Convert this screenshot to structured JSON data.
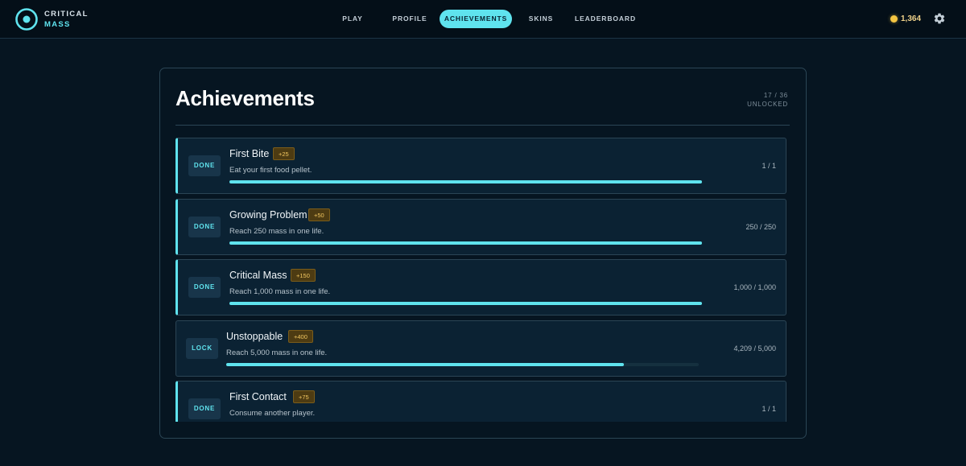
{
  "brand": {
    "line1": "CRITICAL",
    "line2": "MASS"
  },
  "nav": {
    "items": [
      {
        "label": "PLAY",
        "active": false
      },
      {
        "label": "PROFILE",
        "active": false
      },
      {
        "label": "ACHIEVEMENTS",
        "active": true
      },
      {
        "label": "SKINS",
        "active": false
      },
      {
        "label": "LEADERBOARD",
        "active": false
      }
    ]
  },
  "header": {
    "coins": "1,364",
    "coin_icon": "coin-icon",
    "settings_icon": "gear-icon"
  },
  "page": {
    "title": "Achievements",
    "unlocked_count": "17 / 36",
    "unlocked_label": "UNLOCKED"
  },
  "achievements": [
    {
      "status": "DONE",
      "title": "First Bite",
      "reward": "+25",
      "description": "Eat your first food pellet.",
      "progress": "1 / 1",
      "fraction": 1.0
    },
    {
      "status": "DONE",
      "title": "Growing Problem",
      "reward": "+50",
      "description": "Reach 250 mass in one life.",
      "progress": "250 / 250",
      "fraction": 1.0
    },
    {
      "status": "DONE",
      "title": "Critical Mass",
      "reward": "+150",
      "description": "Reach 1,000 mass in one life.",
      "progress": "1,000 / 1,000",
      "fraction": 1.0
    },
    {
      "status": "LOCK",
      "title": "Unstoppable",
      "reward": "+400",
      "description": "Reach 5,000 mass in one life.",
      "progress": "4,209 / 5,000",
      "fraction": 0.8418
    },
    {
      "status": "DONE",
      "title": "First Contact",
      "reward": "+75",
      "description": "Consume another player.",
      "progress": "1 / 1",
      "fraction": 1.0
    }
  ],
  "colors": {
    "accent": "#5fe3ee",
    "background": "#061521",
    "card": "#0b2233",
    "reward_bg": "#4d3b12",
    "reward_text": "#f0c560",
    "coin": "#f4c542"
  }
}
